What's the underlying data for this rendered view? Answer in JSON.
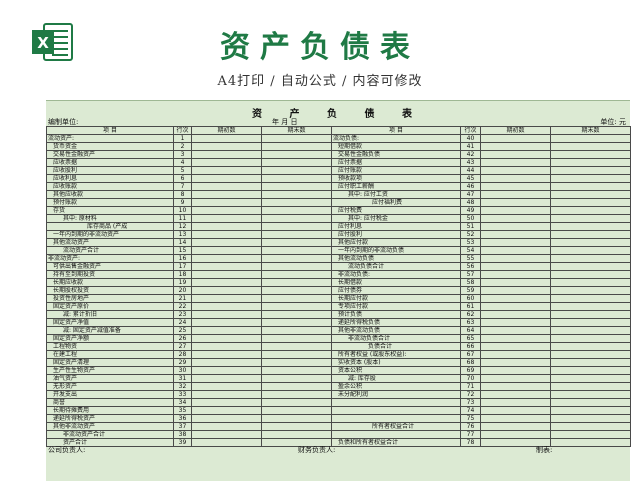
{
  "header": {
    "title": "资产负债表",
    "subtitle": "A4打印 / 自动公式 / 内容可修改"
  },
  "sheet": {
    "title": "资 产 负 债 表",
    "unit_left": "编制单位:",
    "date": "年 月 日",
    "unit_right": "单位: 元",
    "columns": [
      "项 目",
      "行次",
      "期初数",
      "期末数",
      "项 目",
      "行次",
      "期初数",
      "期末数"
    ],
    "rows": [
      [
        "流动资产:",
        "1",
        "流动负债:",
        "40"
      ],
      [
        "货币资金",
        "2",
        "短期借款",
        "41"
      ],
      [
        "交易性金融资产",
        "3",
        "交易性金融负债",
        "42"
      ],
      [
        "应收票据",
        "4",
        "应付票据",
        "43"
      ],
      [
        "应收股利",
        "5",
        "应付账款",
        "44"
      ],
      [
        "应收利息",
        "6",
        "预收款项",
        "45"
      ],
      [
        "应收账款",
        "7",
        "应付职工薪酬",
        "46"
      ],
      [
        "其他应收款",
        "8",
        "其中: 应付工资",
        "47"
      ],
      [
        "预付账款",
        "9",
        "应付福利费",
        "48"
      ],
      [
        "存货",
        "10",
        "应付税费",
        "49"
      ],
      [
        "其中: 原材料",
        "11",
        "其中: 应付税金",
        "50"
      ],
      [
        "库存商品 (产成",
        "12",
        "应付利息",
        "51"
      ],
      [
        "一年内到期的非流动资产",
        "13",
        "应付股利",
        "52"
      ],
      [
        "其他流动资产",
        "14",
        "其他应付款",
        "53"
      ],
      [
        "流动资产合计",
        "15",
        "一年内到期的非流动负债",
        "54"
      ],
      [
        "非流动资产:",
        "16",
        "其他流动负债",
        "55"
      ],
      [
        "可供出售金融资产",
        "17",
        "流动负债合计",
        "56"
      ],
      [
        "持有至到期投资",
        "18",
        "非流动负债:",
        "57"
      ],
      [
        "长期应收款",
        "19",
        "长期借款",
        "58"
      ],
      [
        "长期股权投资",
        "20",
        "应付债券",
        "59"
      ],
      [
        "投资性房地产",
        "21",
        "长期应付款",
        "60"
      ],
      [
        "固定资产原价",
        "22",
        "专项应付款",
        "61"
      ],
      [
        "减: 累计折旧",
        "23",
        "预计负债",
        "62"
      ],
      [
        "固定资产净值",
        "24",
        "递延所得税负债",
        "63"
      ],
      [
        "减: 固定资产减值准备",
        "25",
        "其他非流动负债",
        "64"
      ],
      [
        "固定资产净额",
        "26",
        "非流动负债合计",
        "65"
      ],
      [
        "工程物资",
        "27",
        "负债合计",
        "66"
      ],
      [
        "在建工程",
        "28",
        "所有者权益 (或股东权益):",
        "67"
      ],
      [
        "固定资产清理",
        "29",
        "实收资本 (股本)",
        "68"
      ],
      [
        "生产性生物资产",
        "30",
        "资本公积",
        "69"
      ],
      [
        "油气资产",
        "31",
        "减: 库存股",
        "70"
      ],
      [
        "无形资产",
        "32",
        "盈余公积",
        "71"
      ],
      [
        "开发支出",
        "33",
        "未分配利润",
        "72"
      ],
      [
        "商誉",
        "34",
        "",
        "73"
      ],
      [
        "长期待摊费用",
        "35",
        "",
        "74"
      ],
      [
        "递延所得税资产",
        "36",
        "",
        "75"
      ],
      [
        "其他非流动资产",
        "37",
        "所有者权益合计",
        "76"
      ],
      [
        "非流动资产合计",
        "38",
        "",
        "77"
      ],
      [
        "资产合计",
        "39",
        "负债和所有者权益合计",
        "78"
      ]
    ],
    "footer": {
      "company_head": "公司负责人:",
      "finance_head": "财务负责人:",
      "preparer": "制表:"
    }
  },
  "colors": {
    "accent": "#1f7a45",
    "sheet_bg": "#dcead3"
  },
  "icons": {
    "app_icon": "excel-logo-icon"
  }
}
